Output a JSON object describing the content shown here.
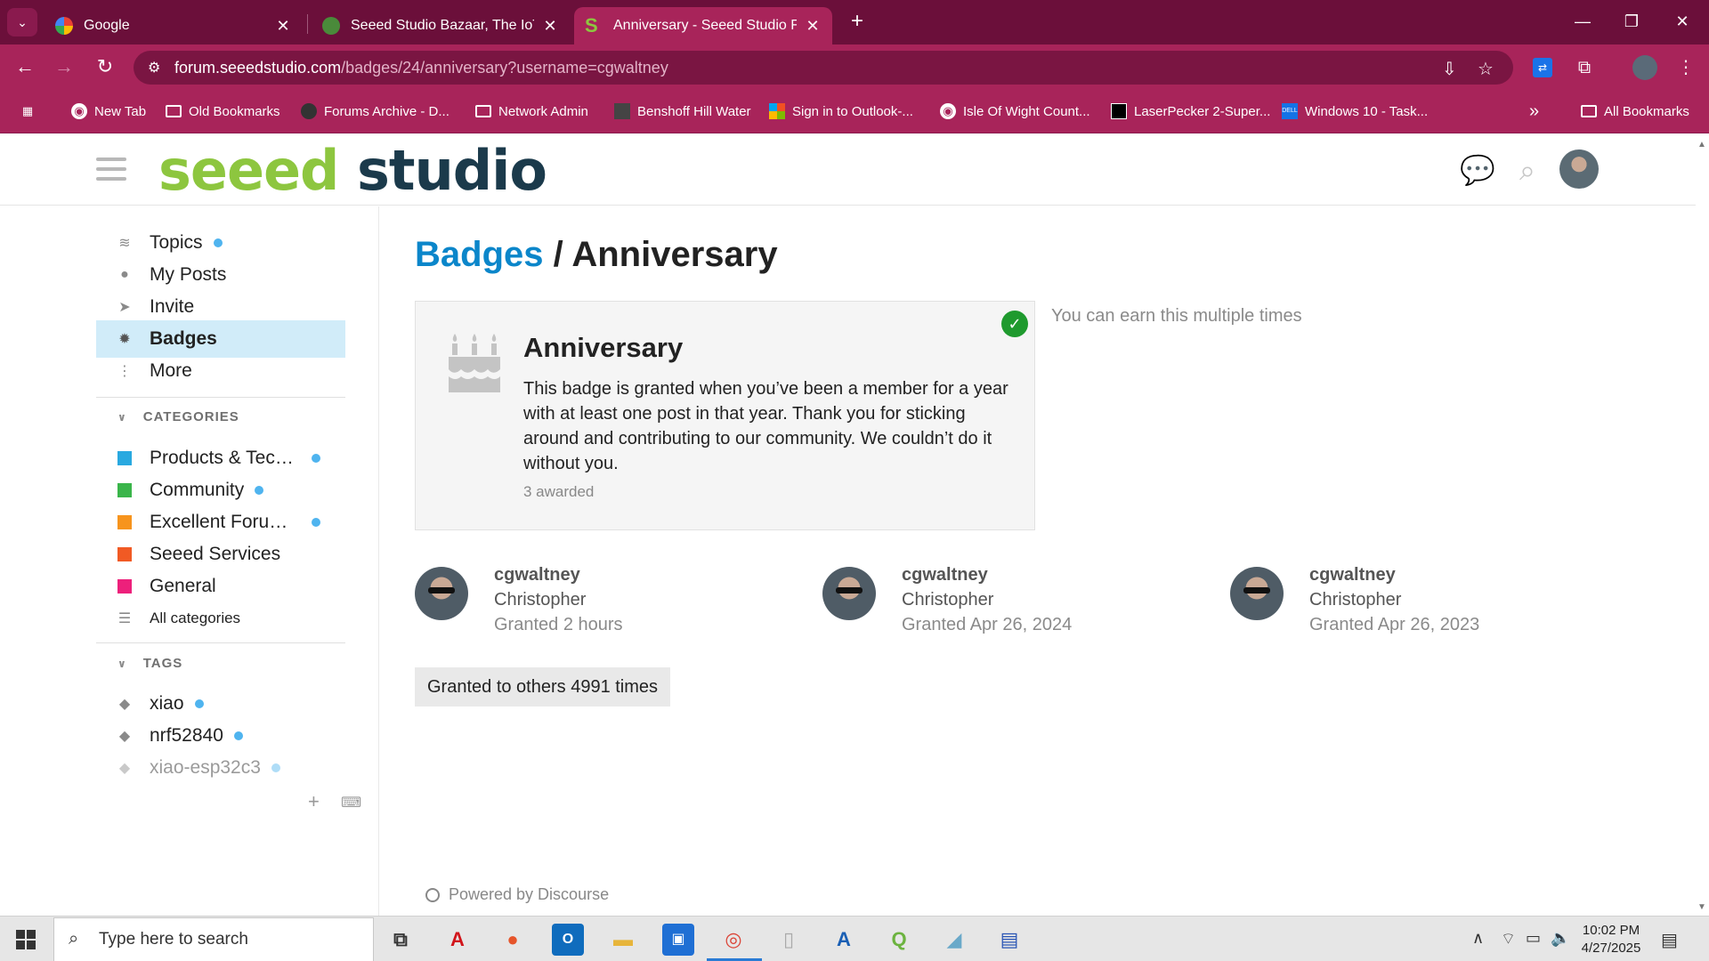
{
  "browser": {
    "tabs": [
      {
        "title": "Google",
        "active": false
      },
      {
        "title": "Seeed Studio Bazaar, The IoT H",
        "active": false
      },
      {
        "title": "Anniversary - Seeed Studio For",
        "active": true
      }
    ],
    "url_host": "forum.seeedstudio.com",
    "url_path": "/badges/24/anniversary?username=cgwaltney",
    "bookmarks": [
      "New Tab",
      "Old Bookmarks",
      "Forums Archive - D...",
      "Network Admin",
      "Benshoff Hill Water",
      "Sign in to Outlook-...",
      "Isle Of Wight Count...",
      "LaserPecker 2-Super...",
      "Windows 10 - Task..."
    ],
    "all_bookmarks": "All Bookmarks",
    "overflow": "»"
  },
  "site": {
    "logo_green": "seeed",
    "logo_dark": "studio"
  },
  "sidebar": {
    "nav": [
      {
        "label": "Topics",
        "icon": "layers-icon",
        "dot": true
      },
      {
        "label": "My Posts",
        "icon": "user-icon",
        "dot": false
      },
      {
        "label": "Invite",
        "icon": "paper-plane-icon",
        "dot": false
      },
      {
        "label": "Badges",
        "icon": "certificate-icon",
        "dot": false,
        "active": true
      },
      {
        "label": "More",
        "icon": "vertical-ellipsis-icon",
        "dot": false
      }
    ],
    "categories_heading": "CATEGORIES",
    "categories": [
      {
        "label": "Products & Tech...",
        "color": "#29a9e0",
        "dot": true
      },
      {
        "label": "Community",
        "color": "#3ab54a",
        "dot": true
      },
      {
        "label": "Excellent Forum ...",
        "color": "#f7941d",
        "dot": true
      },
      {
        "label": "Seeed Services",
        "color": "#f15a24",
        "dot": false
      },
      {
        "label": "General",
        "color": "#ed207b",
        "dot": false
      }
    ],
    "all_categories": "All categories",
    "tags_heading": "TAGS",
    "tags": [
      {
        "label": "xiao",
        "dot": true
      },
      {
        "label": "nrf52840",
        "dot": true
      },
      {
        "label": "xiao-esp32c3",
        "dot": true
      }
    ]
  },
  "main": {
    "breadcrumb_link": "Badges",
    "breadcrumb_sep": " / ",
    "breadcrumb_current": "Anniversary",
    "badge": {
      "title": "Anniversary",
      "description": "This badge is granted when you’ve been a member for a year with at least one post in that year. Thank you for sticking around and contributing to our community. We couldn’t do it without you.",
      "awarded": "3 awarded"
    },
    "earn_note": "You can earn this multiple times",
    "grants": [
      {
        "username": "cgwaltney",
        "name": "Christopher",
        "granted": "Granted 2 hours"
      },
      {
        "username": "cgwaltney",
        "name": "Christopher",
        "granted": "Granted Apr 26, 2024"
      },
      {
        "username": "cgwaltney",
        "name": "Christopher",
        "granted": "Granted Apr 26, 2023"
      }
    ],
    "others_button": "Granted to others 4991 times",
    "powered_by": "Powered by Discourse"
  },
  "taskbar": {
    "search_placeholder": "Type here to search",
    "time": "10:02 PM",
    "date": "4/27/2025"
  },
  "colors": {
    "chrome_dark": "#6b0f3a",
    "chrome_main": "#a8245a",
    "link_blue": "#0b86ca",
    "active_nav": "#d1ecf9",
    "unread_dot": "#4fb4ef",
    "badge_check": "#1f9a2e"
  }
}
